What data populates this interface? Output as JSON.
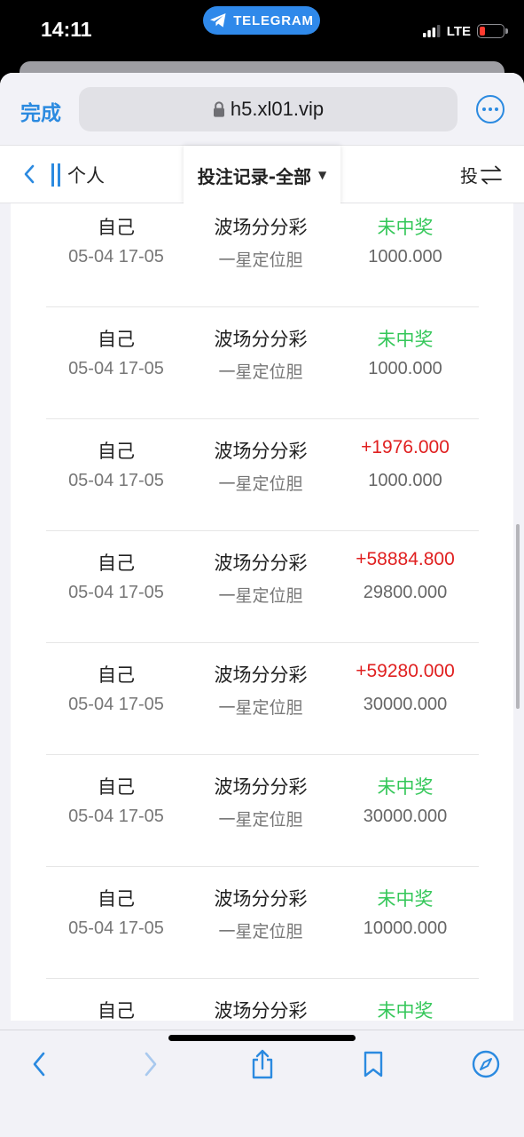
{
  "status_bar": {
    "time": "14:11",
    "telegram_label": "TELEGRAM",
    "network": "LTE"
  },
  "browser": {
    "done_label": "完成",
    "url": "h5.xl01.vip"
  },
  "header": {
    "personal_label": "个人",
    "filter_label": "投注记录-全部",
    "bet_label": "投"
  },
  "records": [
    {
      "user": "自己",
      "time": "05-04 17-05",
      "game": "波场分分彩",
      "play": "一星定位胆",
      "result": "未中奖",
      "result_type": "lose",
      "amount": "1000.000"
    },
    {
      "user": "自己",
      "time": "05-04 17-05",
      "game": "波场分分彩",
      "play": "一星定位胆",
      "result": "未中奖",
      "result_type": "lose",
      "amount": "1000.000"
    },
    {
      "user": "自己",
      "time": "05-04 17-05",
      "game": "波场分分彩",
      "play": "一星定位胆",
      "result": "+1976.000",
      "result_type": "win",
      "amount": "1000.000"
    },
    {
      "user": "自己",
      "time": "05-04 17-05",
      "game": "波场分分彩",
      "play": "一星定位胆",
      "result": "+58884.800",
      "result_type": "win",
      "amount": "29800.000"
    },
    {
      "user": "自己",
      "time": "05-04 17-05",
      "game": "波场分分彩",
      "play": "一星定位胆",
      "result": "+59280.000",
      "result_type": "win",
      "amount": "30000.000"
    },
    {
      "user": "自己",
      "time": "05-04 17-05",
      "game": "波场分分彩",
      "play": "一星定位胆",
      "result": "未中奖",
      "result_type": "lose",
      "amount": "30000.000"
    },
    {
      "user": "自己",
      "time": "05-04 17-05",
      "game": "波场分分彩",
      "play": "一星定位胆",
      "result": "未中奖",
      "result_type": "lose",
      "amount": "10000.000"
    },
    {
      "user": "自己",
      "time": "",
      "game": "波场分分彩",
      "play": "",
      "result": "未中奖",
      "result_type": "lose",
      "amount": ""
    }
  ],
  "colors": {
    "accent": "#2b8ae0",
    "win": "#e02020",
    "lose": "#34c759",
    "telegram": "#2f89ea"
  },
  "toolbar_icons": [
    "back-arrow-icon",
    "forward-arrow-icon",
    "share-icon",
    "bookmarks-icon",
    "compass-icon"
  ]
}
